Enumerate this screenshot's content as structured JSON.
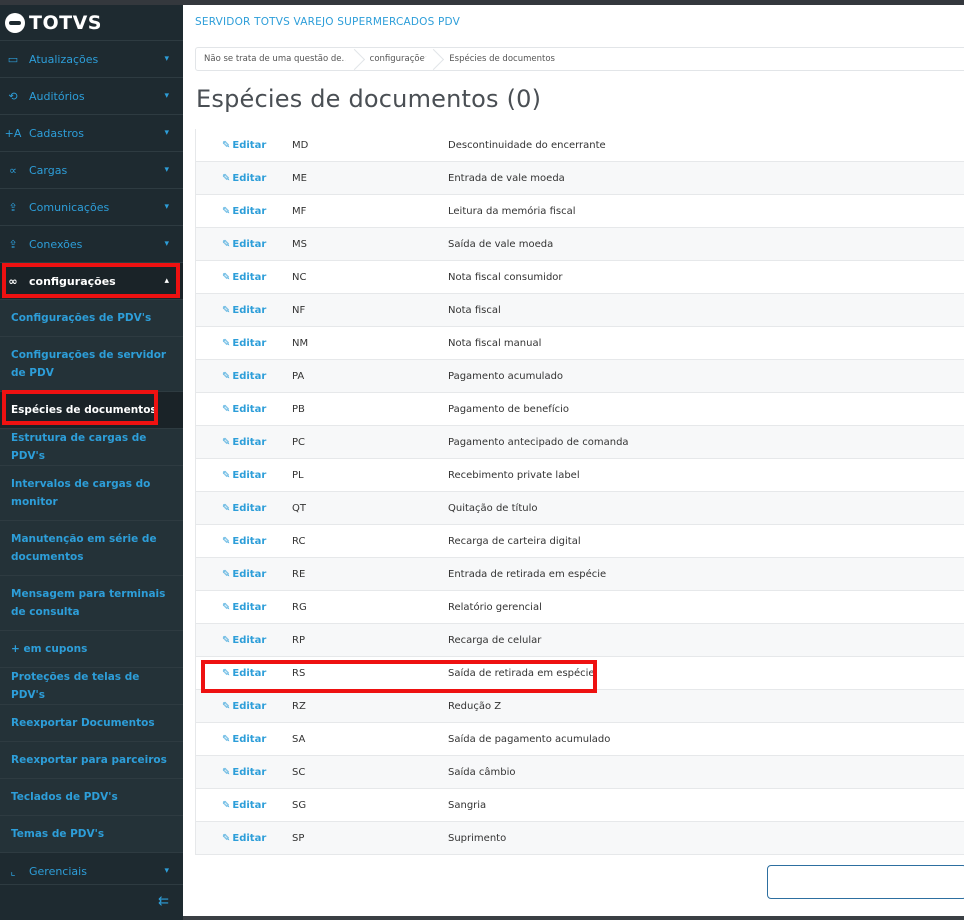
{
  "brand": {
    "logo_text": "TOTVS"
  },
  "sidebar": {
    "groups": [
      {
        "label": "Atualizações",
        "icon": "server-icon"
      },
      {
        "label": "Auditórios",
        "icon": "history-icon"
      },
      {
        "label": "Cadastros",
        "icon": "add-user-icon"
      },
      {
        "label": "Cargas",
        "icon": "share-icon"
      },
      {
        "label": "Comunicações",
        "icon": "file-upload-icon"
      },
      {
        "label": "Conexões",
        "icon": "file-upload-icon"
      },
      {
        "label": "configurações",
        "icon": "link-icon"
      }
    ],
    "subitems": [
      {
        "label": "Configurações de PDV's"
      },
      {
        "label": "Configurações de servidor de PDV"
      },
      {
        "label": "Espécies de documentos"
      },
      {
        "label": "Estrutura de cargas de PDV's"
      },
      {
        "label": "Intervalos de cargas do monitor"
      },
      {
        "label": "Manutenção em série de documentos"
      },
      {
        "label": "Mensagem para terminais de consulta"
      },
      {
        "label": "+ em cupons"
      },
      {
        "label": "Proteções de telas de PDV's"
      },
      {
        "label": "Reexportar Documentos"
      },
      {
        "label": "Reexportar para parceiros"
      },
      {
        "label": "Teclados de PDV's"
      },
      {
        "label": "Temas de PDV's"
      }
    ],
    "last_group": {
      "label": "Gerenciais",
      "icon": "chart-icon"
    }
  },
  "header": {
    "server_title": "SERVIDOR TOTVS VAREJO SUPERMERCADOS PDV",
    "breadcrumb": [
      "Não se trata de uma questão de...",
      "configurações",
      "Espécies de documentos"
    ],
    "page_title": "Espécies de documentos (0)"
  },
  "table": {
    "edit_label": "Editar",
    "rows": [
      {
        "code": "MD",
        "desc": "Descontinuidade do encerrante"
      },
      {
        "code": "ME",
        "desc": "Entrada de vale moeda"
      },
      {
        "code": "MF",
        "desc": "Leitura da memória fiscal"
      },
      {
        "code": "MS",
        "desc": "Saída de vale moeda"
      },
      {
        "code": "NC",
        "desc": "Nota fiscal consumidor"
      },
      {
        "code": "NF",
        "desc": "Nota fiscal"
      },
      {
        "code": "NM",
        "desc": "Nota fiscal manual"
      },
      {
        "code": "PA",
        "desc": "Pagamento acumulado"
      },
      {
        "code": "PB",
        "desc": "Pagamento de benefício"
      },
      {
        "code": "PC",
        "desc": "Pagamento antecipado de comanda"
      },
      {
        "code": "PL",
        "desc": "Recebimento private label"
      },
      {
        "code": "QT",
        "desc": "Quitação de título"
      },
      {
        "code": "RC",
        "desc": "Recarga de carteira digital"
      },
      {
        "code": "RE",
        "desc": "Entrada de retirada em espécie"
      },
      {
        "code": "RG",
        "desc": "Relatório gerencial"
      },
      {
        "code": "RP",
        "desc": "Recarga de celular"
      },
      {
        "code": "RS",
        "desc": "Saída de retirada em espécie"
      },
      {
        "code": "RZ",
        "desc": "Redução Z"
      },
      {
        "code": "SA",
        "desc": "Saída de pagamento acumulado"
      },
      {
        "code": "SC",
        "desc": "Saída câmbio"
      },
      {
        "code": "SG",
        "desc": "Sangria"
      },
      {
        "code": "SP",
        "desc": "Suprimento"
      }
    ]
  },
  "colors": {
    "accent": "#2d9ed9",
    "sidebar_bg": "#1e2a30",
    "highlight": "#ee1111"
  }
}
